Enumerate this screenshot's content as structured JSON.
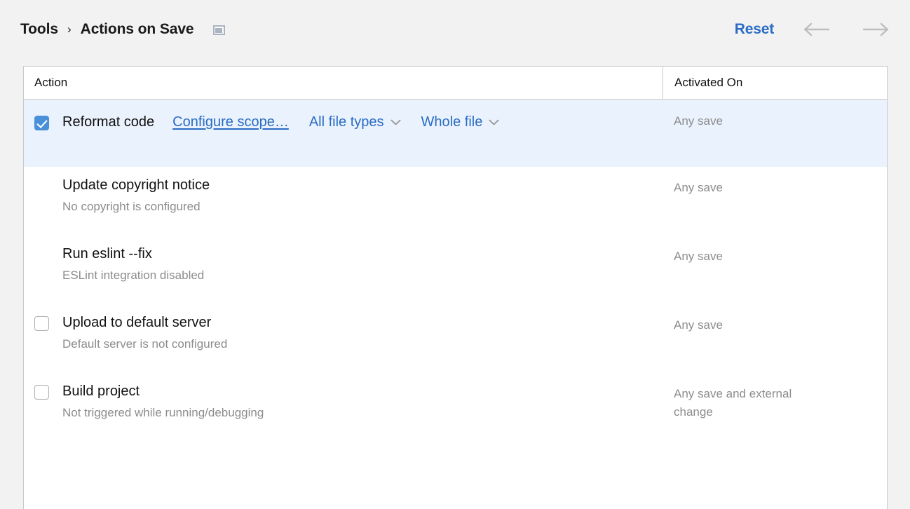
{
  "header": {
    "breadcrumb": {
      "root": "Tools",
      "separator": "›",
      "current": "Actions on Save"
    },
    "panel_icon": "panel-indicator-icon",
    "reset_label": "Reset",
    "back_icon": "arrow-left-icon",
    "forward_icon": "arrow-right-icon",
    "colors": {
      "link": "#2a6cc4",
      "background": "#f2f2f2",
      "arrow": "#bdbdbd"
    }
  },
  "table": {
    "columns": {
      "action": "Action",
      "activated_on": "Activated On"
    },
    "selection_color": "#eaf2fd",
    "rows": [
      {
        "title": "Reformat code",
        "subtitle": "",
        "checkbox": "checked",
        "selected": true,
        "controls": [
          {
            "type": "link",
            "label": "Configure scope…",
            "name": "configure-scope-link"
          },
          {
            "type": "dropdown",
            "label": "All file types",
            "name": "file-types-dropdown"
          },
          {
            "type": "dropdown",
            "label": "Whole file",
            "name": "scope-range-dropdown"
          }
        ],
        "activated_on": "Any save"
      },
      {
        "title": "Update copyright notice",
        "subtitle": "No copyright is configured",
        "checkbox": "none",
        "selected": false,
        "controls": [],
        "activated_on": "Any save"
      },
      {
        "title": "Run eslint --fix",
        "subtitle": "ESLint integration disabled",
        "checkbox": "none",
        "selected": false,
        "controls": [],
        "activated_on": "Any save"
      },
      {
        "title": "Upload to default server",
        "subtitle": "Default server is not configured",
        "checkbox": "unchecked",
        "selected": false,
        "controls": [],
        "activated_on": "Any save"
      },
      {
        "title": "Build project",
        "subtitle": "Not triggered while running/debugging",
        "checkbox": "unchecked",
        "selected": false,
        "controls": [],
        "activated_on": "Any save and external change"
      }
    ]
  }
}
